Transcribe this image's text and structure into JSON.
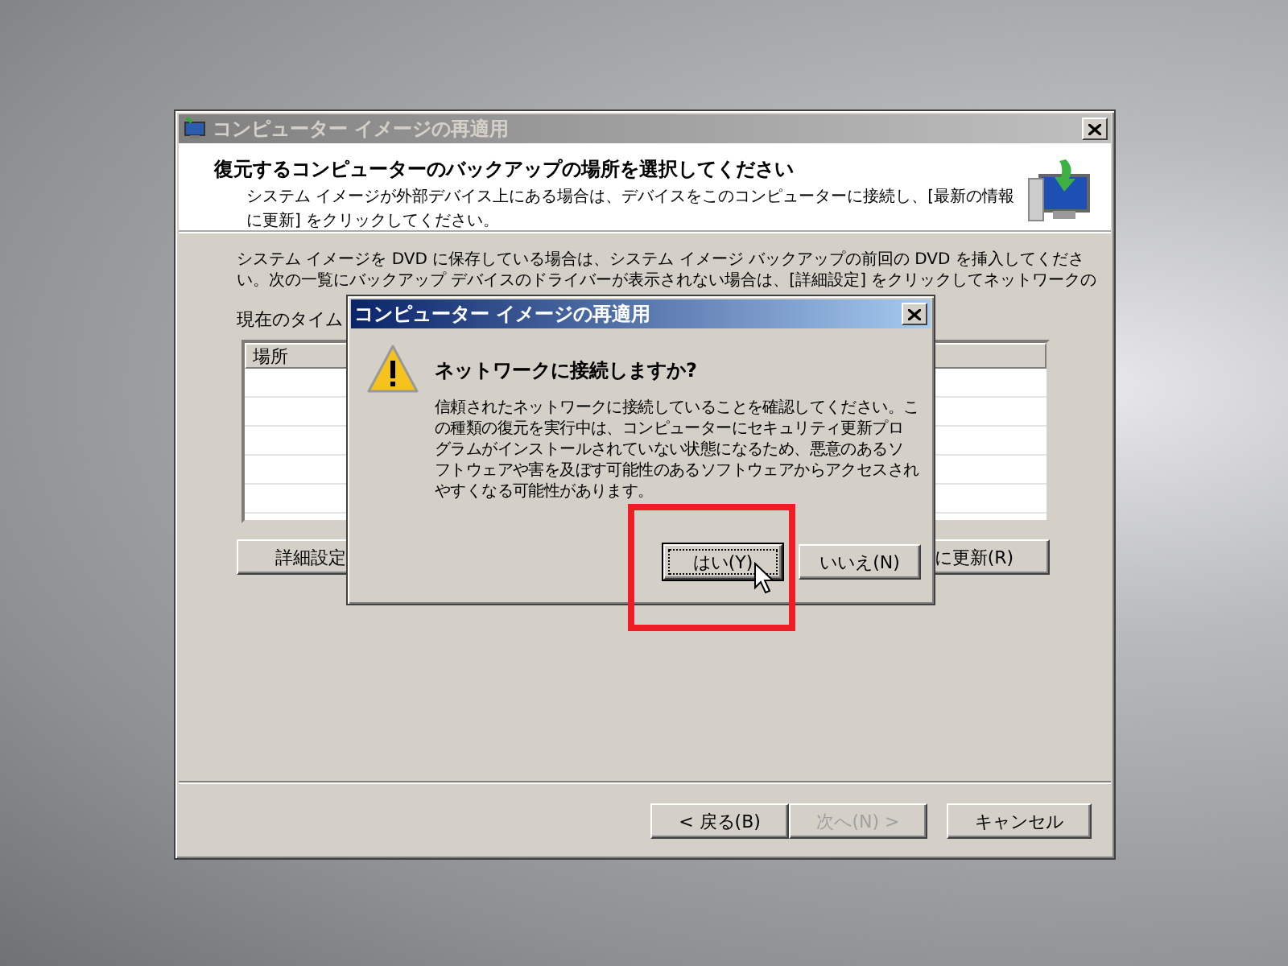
{
  "main_window": {
    "title": "コンピューター イメージの再適用",
    "active": false,
    "header": {
      "heading": "復元するコンピューターのバックアップの場所を選択してください",
      "description_lines": [
        "システム イメージが外部デバイス上にある場合は、デバイスをこのコンピューターに接続し、[最新の情報",
        "に更新] をクリックしてください。"
      ]
    },
    "instruction_lines": [
      "システム イメージを DVD に保存している場合は、システム イメージ バックアップの前回の DVD を挿入してくださ",
      "い。次の一覧にバックアップ デバイスのドライバーが表示されない場合は、[詳細設定] をクリックしてネットワークの"
    ],
    "list_label": "現在のタイム",
    "table": {
      "columns": [
        "場所"
      ]
    },
    "list_buttons": [
      {
        "label": "詳細設定"
      },
      {
        "label": "に更新(R)"
      }
    ],
    "footer_buttons": [
      {
        "label": "< 戻る(B)",
        "disabled": false
      },
      {
        "label": "次へ(N) >",
        "disabled": true
      },
      {
        "label": "キャンセル",
        "disabled": false
      }
    ]
  },
  "dialog": {
    "title": "コンピューター イメージの再適用",
    "active": true,
    "heading": "ネットワークに接続しますか?",
    "message_lines": [
      "信頼されたネットワークに接続していることを確認してください。こ",
      "の種類の復元を実行中は、コンピューターにセキュリティ更新プロ",
      "グラムがインストールされていない状態になるため、悪意のあるソ",
      "フトウェアや害を及ぼす可能性のあるソフトウェアからアクセスされ",
      "やすくなる可能性があります。"
    ],
    "buttons": [
      {
        "label": "はい(Y)",
        "default": true
      },
      {
        "label": "いいえ(N)",
        "default": false
      }
    ]
  }
}
